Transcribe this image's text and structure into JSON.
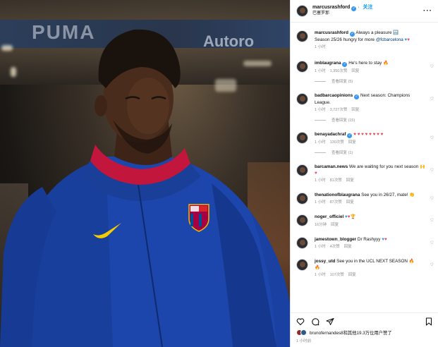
{
  "colors": {
    "accent": "#0095f6",
    "verified": "#3897f0",
    "jersey": "#1f49b0",
    "heart": "#ed4956"
  },
  "photo": {
    "banner_text": "PUMA",
    "banner_text2": "Autoro"
  },
  "header": {
    "username": "marcusrashford",
    "follow_label": "关注",
    "location": "巴塞罗那",
    "more_label": "···"
  },
  "caption": {
    "username": "marcusrashford",
    "text": "Always a pleasure",
    "text2": "Season 25/26 hungry for more",
    "mention": "@fcbarcelona",
    "time": "1 小时"
  },
  "comments": [
    {
      "username": "imblaugrana",
      "text": "He's here to stay",
      "time": "1 小时",
      "likes": "1,350次赞",
      "reply": "回复",
      "replies_label": "查看回复 (5)"
    },
    {
      "username": "badbarcaopinions",
      "text": "Next season: Champions League.",
      "time": "1 小时",
      "likes": "3,727次赞",
      "reply": "回复",
      "replies_label": "查看回复 (15)"
    },
    {
      "username": "benayadachraf",
      "text": "",
      "time": "1 小时",
      "likes": "130次赞",
      "reply": "回复",
      "replies_label": "查看回复 (1)"
    },
    {
      "username": "barcaman.news",
      "text": "We are waiting for you next season",
      "time": "1 小时",
      "likes": "81次赞",
      "reply": "回复"
    },
    {
      "username": "thenationofblaugrana",
      "text": "See you in 26/27, mate!",
      "time": "1 小时",
      "likes": "87次赞",
      "reply": "回复"
    },
    {
      "username": "noger_officiel",
      "text": "",
      "time": "16分钟",
      "reply": "回复"
    },
    {
      "username": "jamestown_blogger",
      "text": "Dr Rashyyy",
      "time": "1 小时",
      "likes": "4次赞",
      "reply": "回复"
    },
    {
      "username": "jossy_utd",
      "text": "See you in the UCL NEXT SEASON",
      "time": "1 小时",
      "likes": "107次赞",
      "reply": "回复"
    }
  ],
  "likes": {
    "text": "brunofernandes8和其他19.3万位用户赞了",
    "time": "1 小时前"
  },
  "icons": [
    "heart-icon",
    "comment-icon",
    "share-icon",
    "bookmark-icon",
    "more-icon",
    "verified-icon"
  ]
}
